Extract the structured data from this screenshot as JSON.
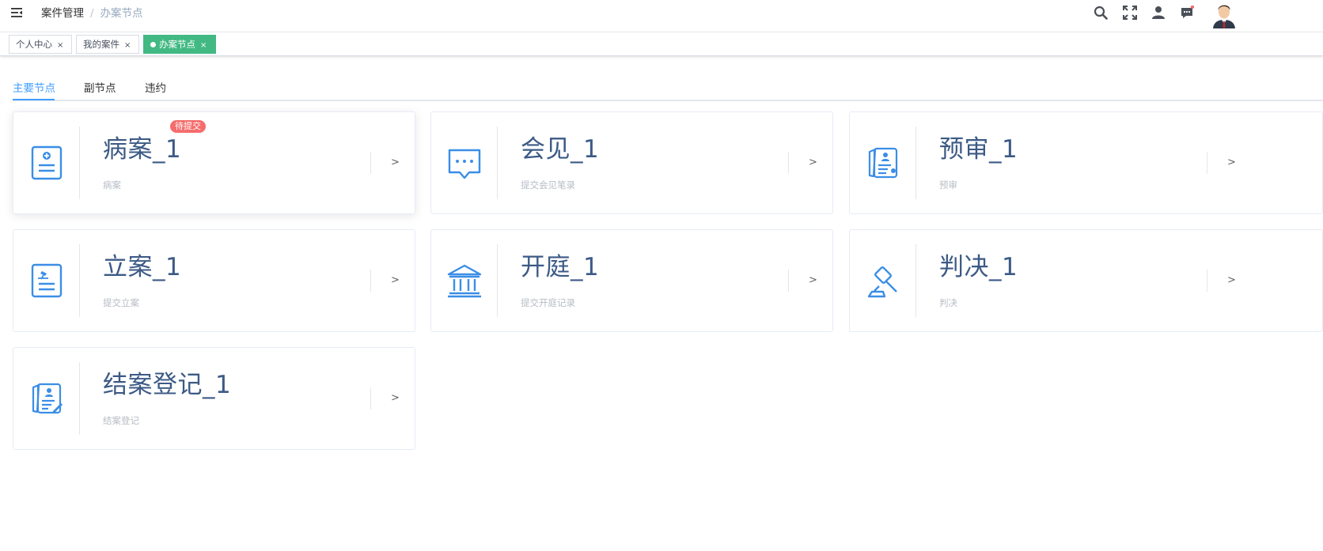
{
  "breadcrumb": {
    "parent": "案件管理",
    "separator": "/",
    "current": "办案节点"
  },
  "tags": [
    {
      "label": "个人中心",
      "close": "×",
      "active": false
    },
    {
      "label": "我的案件",
      "close": "×",
      "active": false
    },
    {
      "label": "办案节点",
      "close": "×",
      "active": true
    }
  ],
  "tabs": [
    {
      "label": "主要节点",
      "active": true
    },
    {
      "label": "副节点",
      "active": false
    },
    {
      "label": "违约",
      "active": false
    }
  ],
  "cards": [
    {
      "icon": "medical-record-icon",
      "title": "病案_1",
      "subtitle": "病案",
      "badge": "待提交",
      "arrow": ">"
    },
    {
      "icon": "chat-bubble-icon",
      "title": "会见_1",
      "subtitle": "提交会见笔录",
      "arrow": ">"
    },
    {
      "icon": "review-document-icon",
      "title": "预审_1",
      "subtitle": "预审",
      "arrow": ">"
    },
    {
      "icon": "filing-document-icon",
      "title": "立案_1",
      "subtitle": "提交立案",
      "arrow": ">"
    },
    {
      "icon": "courthouse-icon",
      "title": "开庭_1",
      "subtitle": "提交开庭记录",
      "arrow": ">"
    },
    {
      "icon": "gavel-icon",
      "title": "判决_1",
      "subtitle": "判决",
      "arrow": ">"
    },
    {
      "icon": "closure-document-icon",
      "title": "结案登记_1",
      "subtitle": "结案登记",
      "arrow": ">"
    }
  ],
  "header_icons": [
    "search-icon",
    "fullscreen-icon",
    "user-icon",
    "message-icon"
  ],
  "colors": {
    "accent": "#409eff",
    "active_tag": "#42b983",
    "badge": "#f56c6c",
    "card_title": "#3c5a86",
    "icon": "#3a8ee6"
  }
}
